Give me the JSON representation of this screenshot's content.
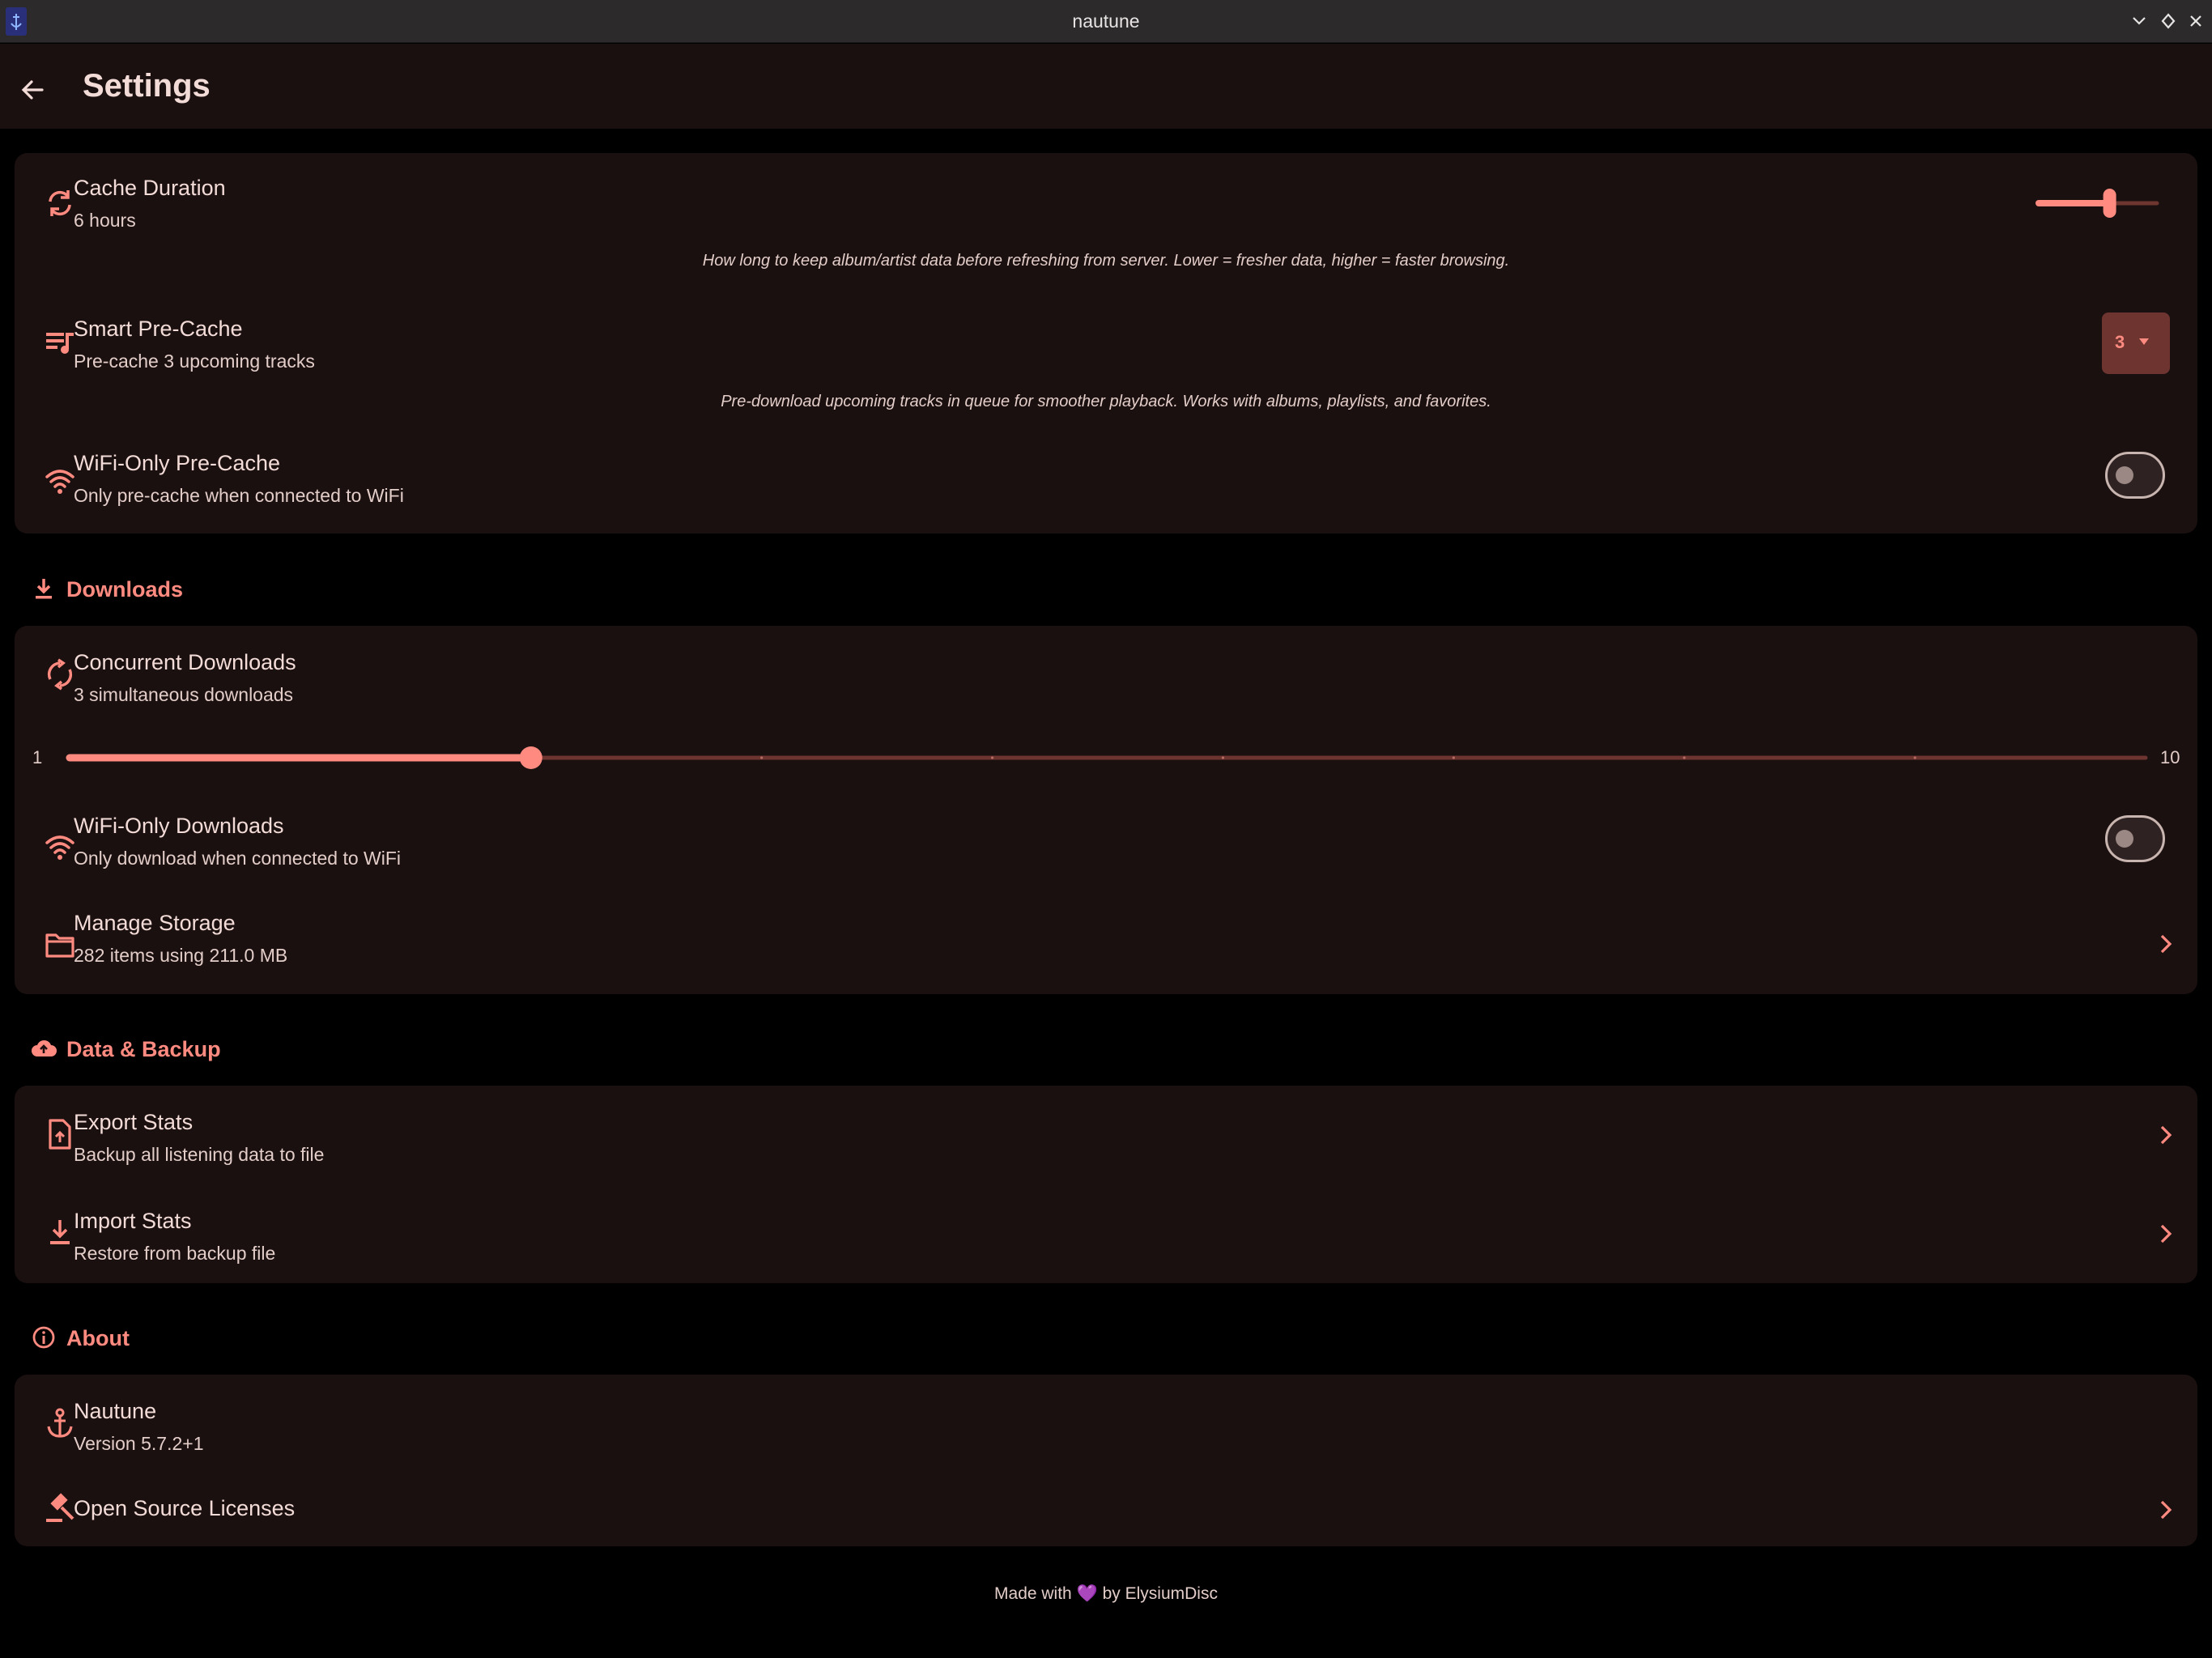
{
  "window": {
    "title": "nautune"
  },
  "appbar": {
    "title": "Settings"
  },
  "cache": {
    "duration_title": "Cache Duration",
    "duration_value": "6 hours",
    "duration_slider_fraction": 0.6,
    "duration_hint": "How long to keep album/artist data before refreshing from server. Lower = fresher data, higher = faster browsing.",
    "precache_title": "Smart Pre-Cache",
    "precache_sub": "Pre-cache 3 upcoming tracks",
    "precache_selected": "3",
    "precache_hint": "Pre-download upcoming tracks in queue for smoother playback. Works with albums, playlists, and favorites.",
    "wifi_precache_title": "WiFi-Only Pre-Cache",
    "wifi_precache_sub": "Only pre-cache when connected to WiFi",
    "wifi_precache_on": false
  },
  "downloads": {
    "section_title": "Downloads",
    "concurrent_title": "Concurrent Downloads",
    "concurrent_sub": "3 simultaneous downloads",
    "concurrent_min": "1",
    "concurrent_max": "10",
    "concurrent_value": 3,
    "wifi_title": "WiFi-Only Downloads",
    "wifi_sub": "Only download when connected to WiFi",
    "wifi_on": false,
    "storage_title": "Manage Storage",
    "storage_sub": "282 items using 211.0 MB"
  },
  "backup": {
    "section_title": "Data & Backup",
    "export_title": "Export Stats",
    "export_sub": "Backup all listening data to file",
    "import_title": "Import Stats",
    "import_sub": "Restore from backup file"
  },
  "about": {
    "section_title": "About",
    "app_title": "Nautune",
    "app_version": "Version 5.7.2+1",
    "licenses_title": "Open Source Licenses"
  },
  "footer": {
    "prefix": "Made with",
    "heart": "💜",
    "suffix": "by ElysiumDisc"
  },
  "colors": {
    "accent": "#ff8a80",
    "card": "#1b1010",
    "background": "#000000"
  }
}
